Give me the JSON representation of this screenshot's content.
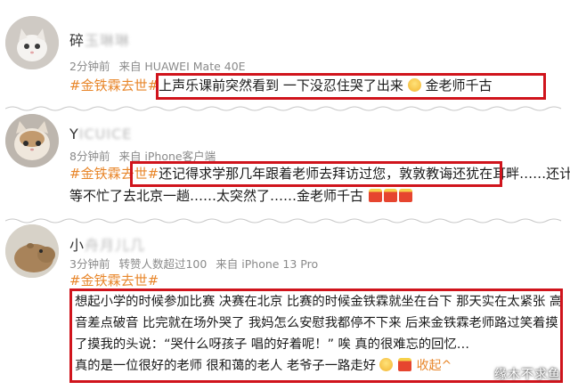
{
  "posts": [
    {
      "username_visible": "碎",
      "username_blurred": "玉琳琳",
      "meta": {
        "time": "2分钟前",
        "source": "来自 HUAWEI Mate 40E"
      },
      "content": {
        "tag": "#金铁霖去世#",
        "highlighted": "上声乐课前突然看到 一下没忍住哭了出来",
        "tail": "金老师千古"
      }
    },
    {
      "username_visible": "Y",
      "username_blurred": "ICUICE",
      "meta": {
        "time": "8分钟前",
        "source": "来自 iPhone客户端"
      },
      "content": {
        "tag": "#金铁霖去世#",
        "highlighted": "还记得求学那几年跟着老师去拜访过您，敦敦教诲还犹在耳畔",
        "line1_tail": "……还计划",
        "line2": "等不忙了去北京一趟……太突然了……金老师千古"
      }
    },
    {
      "username_visible": "小",
      "username_blurred": "舟月儿几",
      "meta": {
        "time": "3分钟前",
        "reposts": "转赞人数超过100",
        "source": "来自 iPhone 13 Pro"
      },
      "content": {
        "tag": "#金铁霖去世#",
        "line1": "想起小学的时候参加比赛 决赛在北京 比赛的时候金铁霖就坐在台下 那天实在太紧张 高",
        "line2": "音差点破音 比完就在场外哭了 我妈怎么安慰我都停不下来 后来金铁霖老师路过笑着摸",
        "line3": "了摸我的头说：“哭什么呀孩子 唱的好着呢！” 唉 真的很难忘的回忆…",
        "line4": "真的是一位很好的老师 很和蔼的老人 老爷子一路走好",
        "collapse": "收起^"
      }
    }
  ],
  "watermark": "缘木不求鱼",
  "colors": {
    "tag": "#e8862a",
    "highlight_border": "#d0141c",
    "meta": "#8a8a8a"
  }
}
